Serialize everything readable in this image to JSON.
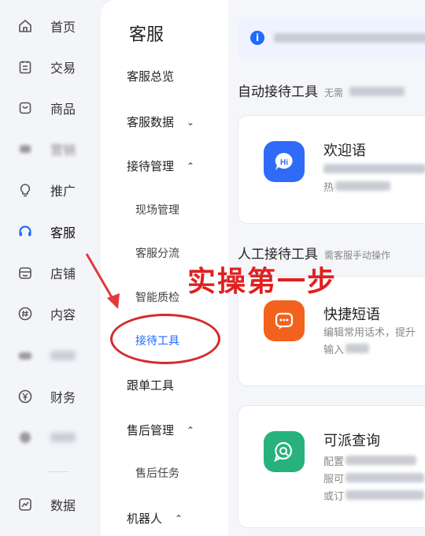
{
  "rail": {
    "items": [
      {
        "label": "首页",
        "icon": "home-icon"
      },
      {
        "label": "交易",
        "icon": "orders-icon"
      },
      {
        "label": "商品",
        "icon": "goods-icon"
      },
      {
        "label": "营销",
        "icon": "blurred-icon"
      },
      {
        "label": "推广",
        "icon": "bulb-icon"
      },
      {
        "label": "客服",
        "icon": "headset-icon"
      },
      {
        "label": "店铺",
        "icon": "store-icon"
      },
      {
        "label": "内容",
        "icon": "hash-icon"
      },
      {
        "label": "",
        "icon": "blurred-icon"
      },
      {
        "label": "财务",
        "icon": "yen-icon"
      },
      {
        "label": "",
        "icon": "blurred-icon"
      },
      {
        "label": "数据",
        "icon": "chart-icon"
      }
    ],
    "active": "客服"
  },
  "submenu": {
    "title": "客服",
    "overview": "客服总览",
    "data": "客服数据",
    "reception": "接待管理",
    "scene": "现场管理",
    "routing": "客服分流",
    "quality": "智能质检",
    "tools": "接待工具",
    "followup": "跟单工具",
    "aftersale": "售后管理",
    "aftersale_task": "售后任务",
    "robot": "机器人"
  },
  "main": {
    "auto_title": "自动接待工具",
    "auto_sub": "无需",
    "manual_title": "人工接待工具",
    "manual_sub": "需客服手动操作",
    "cards": [
      {
        "name": "欢迎语",
        "desc1": "",
        "desc2": "热",
        "icon_text": "Hi",
        "color": "#2f6bf6"
      },
      {
        "name": "快捷短语",
        "desc1": "编辑常用话术，提升",
        "desc2": "输入",
        "icon_text": "…",
        "color": "#f2621c"
      },
      {
        "name": "可派查询",
        "desc1": "配置",
        "desc2": "服可",
        "desc3": "或订",
        "icon_text": "Q",
        "color": "#27b27c"
      }
    ]
  },
  "annotation": {
    "text": "实操第一步",
    "color": "#e02020"
  }
}
